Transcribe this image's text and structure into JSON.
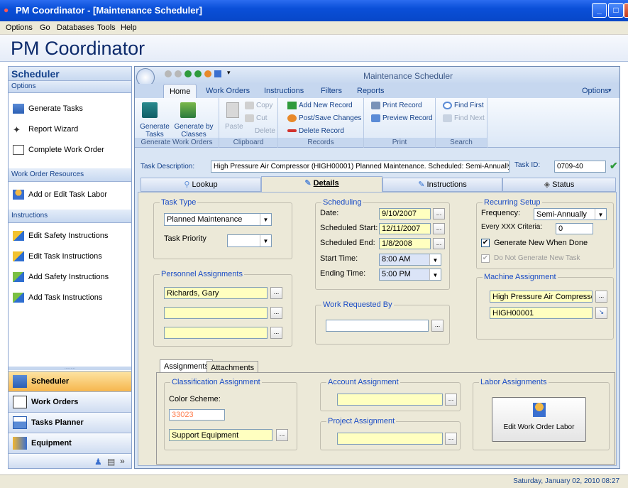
{
  "window": {
    "title": "PM Coordinator - [Maintenance Scheduler]"
  },
  "menu": [
    "Options",
    "Go",
    "Databases",
    "Tools",
    "Help"
  ],
  "app_title": "PM Coordinator",
  "left": {
    "header": "Scheduler",
    "options_label": "Options",
    "options_items": [
      "Generate Tasks",
      "Report Wizard",
      "Complete Work Order"
    ],
    "resources_label": "Work Order Resources",
    "resources_items": [
      "Add or Edit Task Labor"
    ],
    "instructions_label": "Instructions",
    "instructions_items": [
      "Edit Safety Instructions",
      "Edit Task Instructions",
      "Add Safety Instructions",
      "Add Task Instructions"
    ],
    "nav": [
      "Scheduler",
      "Work Orders",
      "Tasks Planner",
      "Equipment"
    ]
  },
  "ribbon": {
    "title": "Maintenance Scheduler",
    "tabs": [
      "Home",
      "Work Orders",
      "Instructions",
      "Filters",
      "Reports"
    ],
    "options_label": "Options",
    "groups": {
      "generate": {
        "label": "Generate Work Orders",
        "b1": "Generate Tasks",
        "b2": "Generate by Classes"
      },
      "clipboard": {
        "label": "Clipboard",
        "paste": "Paste",
        "copy": "Copy",
        "cut": "Cut",
        "delete": "Delete"
      },
      "records": {
        "label": "Records",
        "add": "Add New Record",
        "post": "Post/Save Changes",
        "del": "Delete Record"
      },
      "print": {
        "label": "Print",
        "print": "Print Record",
        "preview": "Preview Record"
      },
      "search": {
        "label": "Search",
        "first": "Find First",
        "next": "Find Next"
      }
    }
  },
  "task": {
    "desc_label": "Task Description:",
    "desc_value": "High Pressure Air Compressor (HIGH00001) Planned Maintenance. Scheduled: Semi-Annually",
    "id_label": "Task ID:",
    "id_value": "0709-40"
  },
  "main_tabs": [
    "Lookup",
    "Details",
    "Instructions",
    "Status"
  ],
  "details": {
    "task_type": {
      "legend": "Task Type",
      "value": "Planned Maintenance",
      "priority_label": "Task Priority",
      "priority_value": ""
    },
    "personnel": {
      "legend": "Personnel Assignments",
      "values": [
        "Richards, Gary",
        "",
        ""
      ]
    },
    "scheduling": {
      "legend": "Scheduling",
      "date_label": "Date:",
      "date": "9/10/2007",
      "start_label": "Scheduled Start:",
      "start": "12/11/2007",
      "end_label": "Scheduled End:",
      "end": "1/8/2008",
      "stime_label": "Start Time:",
      "stime": "8:00 AM",
      "etime_label": "Ending Time:",
      "etime": "5:00 PM"
    },
    "work_requested": {
      "legend": "Work Requested By",
      "value": ""
    },
    "recurring": {
      "legend": "Recurring Setup",
      "freq_label": "Frequency:",
      "freq": "Semi-Annually",
      "crit_label": "Every XXX Criteria:",
      "crit": "0",
      "gen_new": "Generate New When Done",
      "no_gen": "Do Not Generate New Task"
    },
    "machine": {
      "legend": "Machine Assignment",
      "name": "High Pressure Air Compressor",
      "id": "HIGH00001"
    }
  },
  "sub_tabs": [
    "Assignments",
    "Attachments"
  ],
  "assign": {
    "classification": {
      "legend": "Classification Assignment",
      "color_label": "Color Scheme:",
      "color_value": "33023",
      "value": "Support Equipment"
    },
    "account": {
      "legend": "Account Assignment",
      "value": ""
    },
    "project": {
      "legend": "Project Assignment",
      "value": ""
    },
    "labor": {
      "legend": "Labor Assignments",
      "button": "Edit Work Order Labor"
    }
  },
  "status": "Saturday, January 02, 2010 08:27"
}
